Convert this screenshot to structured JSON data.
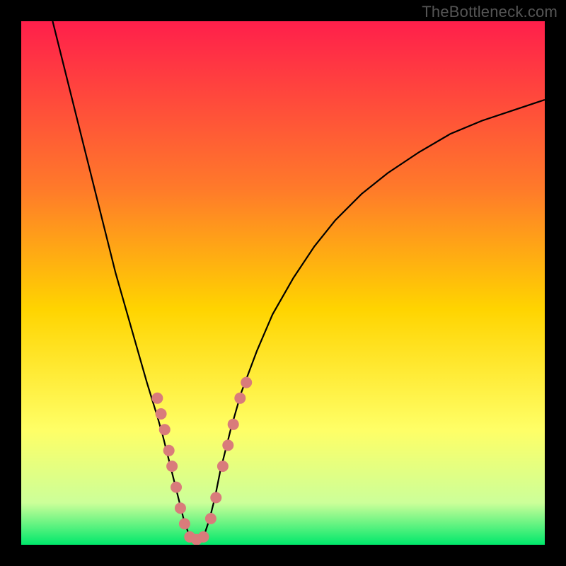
{
  "watermark": "TheBottleneck.com",
  "chart_data": {
    "type": "line",
    "title": "",
    "xlabel": "",
    "ylabel": "",
    "xlim": [
      0,
      100
    ],
    "ylim": [
      0,
      100
    ],
    "grid": false,
    "legend": false,
    "gradient_colors": {
      "top": "#ff1f4b",
      "mid1": "#ff7a2a",
      "mid2": "#ffd400",
      "mid3": "#ffff66",
      "mid4": "#ccff99",
      "bottom": "#00e86b"
    },
    "series": [
      {
        "name": "bottleneck-curve",
        "color": "#000000",
        "x": [
          6.0,
          8.0,
          10.0,
          12.0,
          14.0,
          16.0,
          18.0,
          20.0,
          22.0,
          24.0,
          26.0,
          27.0,
          28.0,
          29.0,
          30.0,
          31.0,
          32.0,
          33.0,
          34.0,
          35.0,
          36.0,
          37.0,
          38.0,
          40.0,
          42.0,
          45.0,
          48.0,
          52.0,
          56.0,
          60.0,
          65.0,
          70.0,
          76.0,
          82.0,
          88.0,
          94.0,
          100.0
        ],
        "y": [
          100.0,
          92.0,
          84.0,
          76.0,
          68.0,
          60.0,
          52.0,
          45.0,
          38.0,
          31.0,
          24.5,
          21.0,
          17.0,
          13.0,
          9.0,
          5.0,
          2.0,
          1.0,
          1.0,
          2.0,
          5.0,
          9.0,
          14.0,
          22.0,
          29.0,
          37.0,
          44.0,
          51.0,
          57.0,
          62.0,
          67.0,
          71.0,
          75.0,
          78.5,
          81.0,
          83.0,
          85.0
        ]
      }
    ],
    "points": {
      "name": "highlight-points",
      "color": "#d97b7b",
      "radius": 8,
      "data": [
        {
          "x": 26.0,
          "y": 28.0
        },
        {
          "x": 26.7,
          "y": 25.0
        },
        {
          "x": 27.4,
          "y": 22.0
        },
        {
          "x": 28.2,
          "y": 18.0
        },
        {
          "x": 28.8,
          "y": 15.0
        },
        {
          "x": 29.6,
          "y": 11.0
        },
        {
          "x": 30.4,
          "y": 7.0
        },
        {
          "x": 31.2,
          "y": 4.0
        },
        {
          "x": 32.2,
          "y": 1.5
        },
        {
          "x": 33.5,
          "y": 1.0
        },
        {
          "x": 34.8,
          "y": 1.5
        },
        {
          "x": 36.2,
          "y": 5.0
        },
        {
          "x": 37.2,
          "y": 9.0
        },
        {
          "x": 38.5,
          "y": 15.0
        },
        {
          "x": 39.5,
          "y": 19.0
        },
        {
          "x": 40.5,
          "y": 23.0
        },
        {
          "x": 41.8,
          "y": 28.0
        },
        {
          "x": 43.0,
          "y": 31.0
        }
      ]
    }
  }
}
